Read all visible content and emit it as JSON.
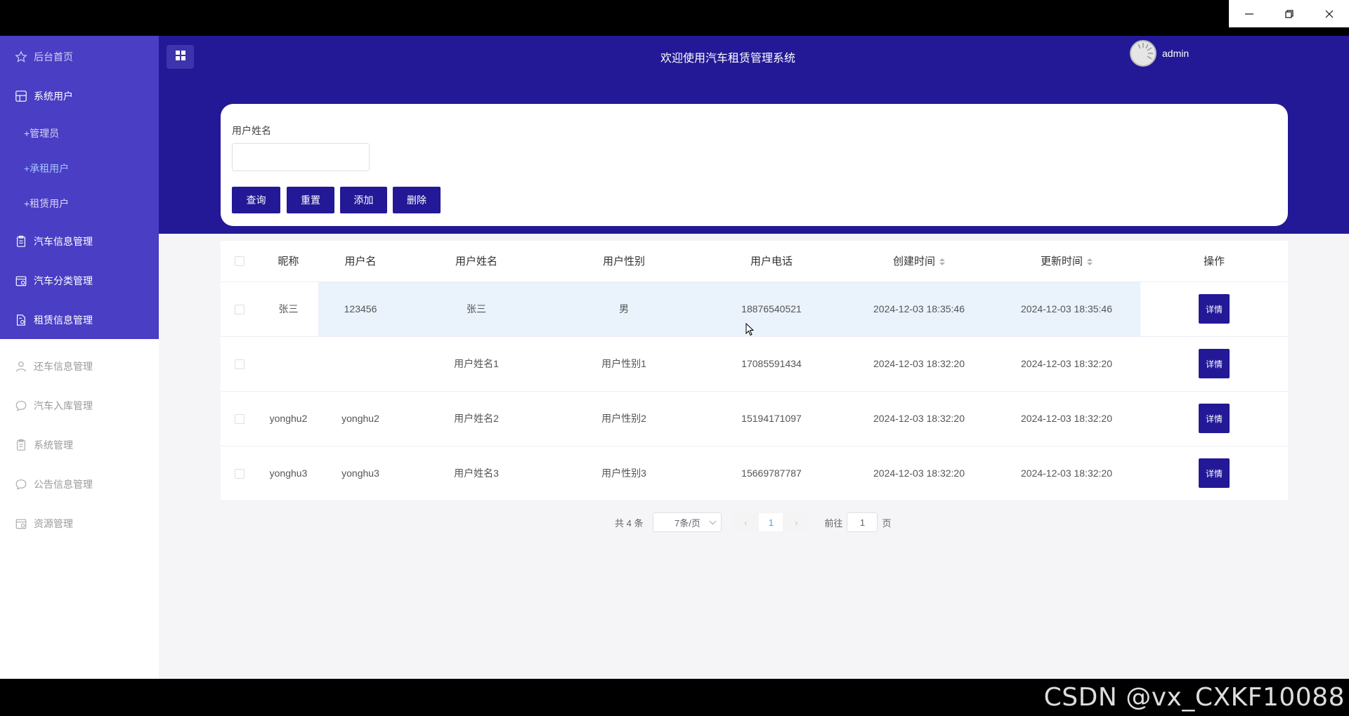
{
  "window": {
    "minimize_icon": "minimize-icon",
    "restore_icon": "restore-icon",
    "close_icon": "close-icon"
  },
  "watermark": "CSDN @vx_CXKF10088",
  "header": {
    "title": "欢迎使用汽车租赁管理系统",
    "username": "admin",
    "color": "#231996"
  },
  "sidebar": {
    "items": [
      {
        "label": "后台首页",
        "icon": "star-icon"
      },
      {
        "label": "系统用户",
        "icon": "grid-icon"
      },
      {
        "label": "+管理员"
      },
      {
        "label": "+承租用户"
      },
      {
        "label": "+租赁用户"
      },
      {
        "label": "汽车信息管理",
        "icon": "clipboard-icon"
      },
      {
        "label": "汽车分类管理",
        "icon": "calendar-icon"
      },
      {
        "label": "租赁信息管理",
        "icon": "document-icon"
      },
      {
        "label": "还车信息管理",
        "icon": "user-icon"
      },
      {
        "label": "汽车入库管理",
        "icon": "chat-icon"
      },
      {
        "label": "系统管理",
        "icon": "clipboard-icon"
      },
      {
        "label": "公告信息管理",
        "icon": "chat-icon"
      },
      {
        "label": "资源管理",
        "icon": "calendar-icon"
      }
    ]
  },
  "search": {
    "label": "用户姓名",
    "value": "",
    "buttons": {
      "query": "查询",
      "reset": "重置",
      "add": "添加",
      "delete": "删除"
    }
  },
  "table": {
    "headers": [
      "昵称",
      "用户名",
      "用户姓名",
      "用户性别",
      "用户电话",
      "创建时间",
      "更新时间",
      "操作"
    ],
    "rows": [
      {
        "nickname": "张三",
        "username": "123456",
        "realname": "张三",
        "gender": "男",
        "phone": "18876540521",
        "created": "2024-12-03 18:35:46",
        "updated": "2024-12-03 18:35:46",
        "action": "详情"
      },
      {
        "nickname": "",
        "username": "",
        "realname": "用户姓名1",
        "gender": "用户性别1",
        "phone": "17085591434",
        "created": "2024-12-03 18:32:20",
        "updated": "2024-12-03 18:32:20",
        "action": "详情"
      },
      {
        "nickname": "yonghu2",
        "username": "yonghu2",
        "realname": "用户姓名2",
        "gender": "用户性别2",
        "phone": "15194171097",
        "created": "2024-12-03 18:32:20",
        "updated": "2024-12-03 18:32:20",
        "action": "详情"
      },
      {
        "nickname": "yonghu3",
        "username": "yonghu3",
        "realname": "用户姓名3",
        "gender": "用户性别3",
        "phone": "15669787787",
        "created": "2024-12-03 18:32:20",
        "updated": "2024-12-03 18:32:20",
        "action": "详情"
      }
    ]
  },
  "pagination": {
    "total": "共 4 条",
    "page_size": "7条/页",
    "current": "1",
    "goto_prefix": "前往",
    "goto_value": "1",
    "goto_suffix": "页"
  }
}
